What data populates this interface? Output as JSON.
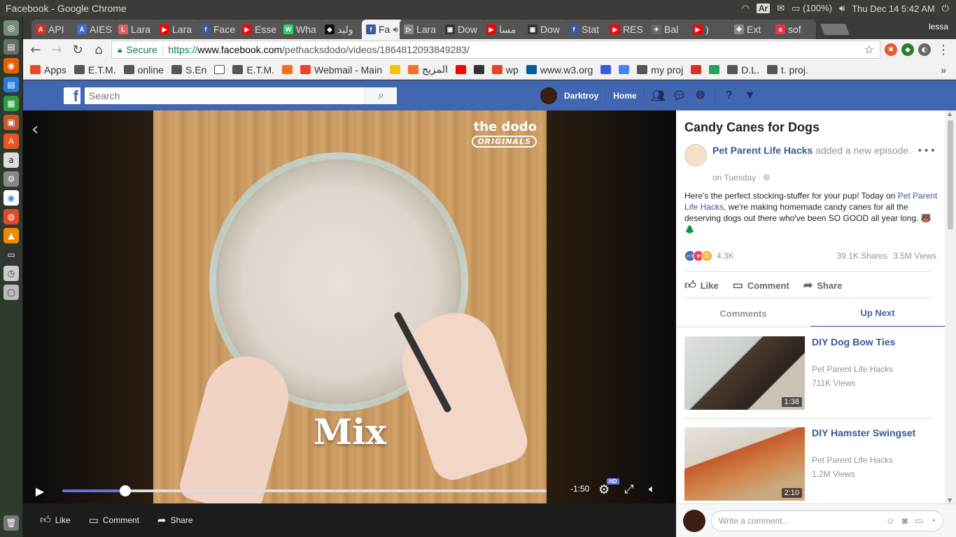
{
  "os": {
    "window_title": "Facebook - Google Chrome",
    "keyboard": "Ar",
    "battery": "(100%)",
    "clock": "Thu Dec 14  5:42 AM",
    "user": "lessa"
  },
  "chrome": {
    "tabs": [
      {
        "label": "API",
        "color": "#d93025",
        "glyph": "A"
      },
      {
        "label": "AIES",
        "color": "#3b6fd8",
        "glyph": "A"
      },
      {
        "label": "Lara",
        "color": "#e25d5d",
        "glyph": "L"
      },
      {
        "label": "Lara",
        "color": "#ff0000",
        "glyph": "▶"
      },
      {
        "label": "Face",
        "color": "#3b5998",
        "glyph": "f"
      },
      {
        "label": "Esse",
        "color": "#ff0000",
        "glyph": "▶"
      },
      {
        "label": "Wha",
        "color": "#25d366",
        "glyph": "W"
      },
      {
        "label": "وليد",
        "color": "#111",
        "glyph": "◆"
      },
      {
        "label": "Fa",
        "color": "#3b5998",
        "glyph": "f",
        "active": true
      },
      {
        "label": "Lara",
        "color": "#888",
        "glyph": "▷"
      },
      {
        "label": "Dow",
        "color": "#333",
        "glyph": "▣"
      },
      {
        "label": "مسا",
        "color": "#ff0000",
        "glyph": "▶"
      },
      {
        "label": "Dow",
        "color": "#333",
        "glyph": "▣"
      },
      {
        "label": "Stat",
        "color": "#3b5998",
        "glyph": "f"
      },
      {
        "label": "RES",
        "color": "#ff0000",
        "glyph": "▶"
      },
      {
        "label": "Bal",
        "color": "#666",
        "glyph": "✈"
      },
      {
        "label": ")",
        "color": "#ff0000",
        "glyph": "▶"
      },
      {
        "label": "Ext",
        "color": "#888",
        "glyph": "✚"
      },
      {
        "label": "sof",
        "color": "#e8334a",
        "glyph": "a"
      }
    ],
    "active_tab_close": "×",
    "profile_label": "lessa",
    "omnibox": {
      "secure_label": "Secure",
      "scheme": "https://",
      "host": "www.facebook.com",
      "path": "/pethacksdodo/videos/1864812093849283/"
    },
    "bookmarks": [
      {
        "label": "Apps",
        "type": "apps"
      },
      {
        "label": "E.T.M.",
        "type": "folder"
      },
      {
        "label": "online",
        "type": "folder"
      },
      {
        "label": "S.En",
        "type": "folder"
      },
      {
        "label": "",
        "type": "page"
      },
      {
        "label": "E.T.M.",
        "type": "folder"
      },
      {
        "label": "",
        "type": "soundcloud"
      },
      {
        "label": "Webmail - Main",
        "type": "link"
      },
      {
        "label": "",
        "type": "yellow"
      },
      {
        "label": "المزيج",
        "type": "soundcloud"
      },
      {
        "label": "",
        "type": "youtube"
      },
      {
        "label": "",
        "type": "download"
      },
      {
        "label": "wp",
        "type": "link"
      },
      {
        "label": "www.w3.org",
        "type": "w3"
      },
      {
        "label": "",
        "type": "cloud"
      },
      {
        "label": "",
        "type": "google"
      },
      {
        "label": "my proj",
        "type": "folder"
      },
      {
        "label": "",
        "type": "gmail"
      },
      {
        "label": "",
        "type": "drive"
      },
      {
        "label": "D.L.",
        "type": "folder"
      },
      {
        "label": "t. proj.",
        "type": "folder"
      }
    ],
    "bookmarks_more": "»"
  },
  "facebook": {
    "search_placeholder": "Search",
    "user_name": "Darktroy",
    "home_label": "Home"
  },
  "video": {
    "brand_line1": "the dodo",
    "brand_line2": "ORIGINALS",
    "caption": "Mix",
    "time_remaining": "-1:50",
    "hd_label": "HD",
    "progress": 0.13,
    "actions": {
      "like": "Like",
      "comment": "Comment",
      "share": "Share"
    }
  },
  "post": {
    "title": "Candy Canes for Dogs",
    "page_name": "Pet Parent Life Hacks",
    "action_text": "added a new episode.",
    "time": "on Tuesday ·",
    "body_before": "Here's the perfect stocking-stuffer for your pup! Today on ",
    "body_link": "Pet Parent Life Hacks",
    "body_after": ", we're making homemade candy canes for all the deserving dogs out there who've been SO GOOD all year long. 🐻 🌲",
    "reactions_count": "4.3K",
    "shares": "39.1K Shares",
    "views": "3.5M Views",
    "actions": {
      "like": "Like",
      "comment": "Comment",
      "share": "Share"
    }
  },
  "side_tabs": {
    "comments": "Comments",
    "up_next": "Up Next"
  },
  "up_next": [
    {
      "title": "DIY Dog Bow Ties",
      "page": "Pet Parent Life Hacks",
      "views": "711K Views",
      "duration": "1:38"
    },
    {
      "title": "DIY Hamster Swingset",
      "page": "Pet Parent Life Hacks",
      "views": "1.2M Views",
      "duration": "2:10"
    }
  ],
  "comment_box": {
    "placeholder": "Write a comment..."
  }
}
